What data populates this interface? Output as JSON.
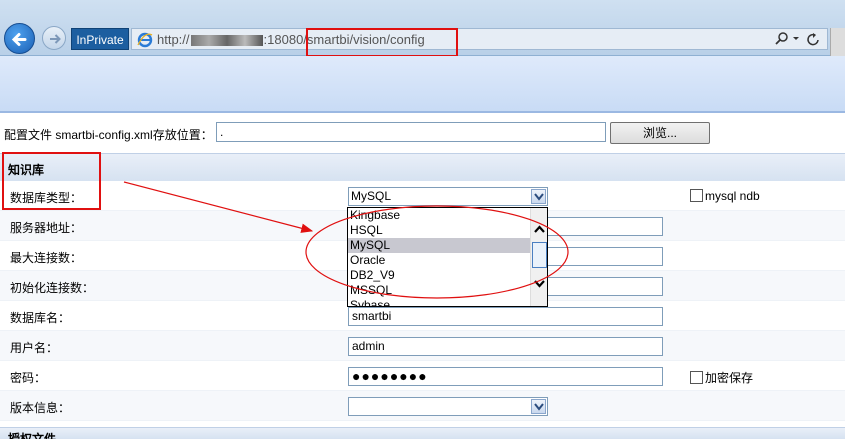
{
  "browser": {
    "inprivate_label": "InPrivate",
    "url_prefix": "http://",
    "url_suffix": ":18080/smartbi/vision/config",
    "address_tools": "ᓬ ▾ ↻"
  },
  "config_file": {
    "label": "配置文件 smartbi-config.xml存放位置：",
    "value": ".",
    "browse_label": "浏览..."
  },
  "knowledge_base": {
    "title": "知识库",
    "rows": [
      {
        "label": "数据库类型：",
        "type": "select",
        "value": "MySQL"
      },
      {
        "label": "服务器地址：",
        "type": "input",
        "value": ""
      },
      {
        "label": "最大连接数：",
        "type": "input",
        "value": ""
      },
      {
        "label": "初始化连接数：",
        "type": "input",
        "value": ""
      },
      {
        "label": "数据库名：",
        "type": "input",
        "value": "smartbi"
      },
      {
        "label": "用户名：",
        "type": "input",
        "value": "admin"
      },
      {
        "label": "密码：",
        "type": "password",
        "value": "●●●●●●●●"
      },
      {
        "label": "版本信息：",
        "type": "select",
        "value": ""
      }
    ],
    "mysql_ndb_label": "mysql ndb",
    "encrypt_save_label": "加密保存"
  },
  "dropdown": {
    "options": [
      "Kingbase",
      "HSQL",
      "MySQL",
      "Oracle",
      "DB2_V9",
      "MSSQL",
      "Sybase"
    ],
    "selected": "MySQL"
  },
  "next_section": {
    "title": "授权文件"
  },
  "colors": {
    "annotation": "#e01010",
    "section_bg": "#d6e2f1"
  }
}
